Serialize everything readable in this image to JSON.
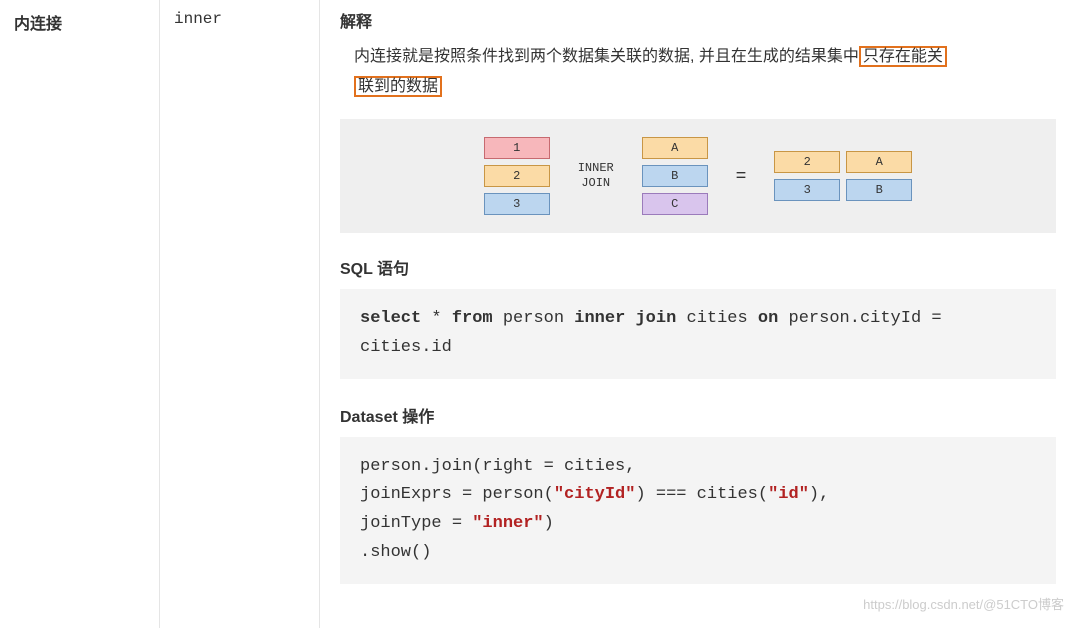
{
  "left": {
    "title": "内连接"
  },
  "mid": {
    "keyword": "inner"
  },
  "sections": {
    "explain_h": "解释",
    "explain_pre": "内连接就是按照条件找到两个数据集关联的数据, 并且在生成的结果集中",
    "explain_hl1": "只存在能关",
    "explain_hl2": "联到的数据",
    "sql_h": "SQL 语句",
    "dataset_h": "Dataset 操作"
  },
  "diagram": {
    "op": "INNER\nJOIN",
    "eq": "=",
    "left": [
      {
        "v": "1",
        "cls": "c-pink"
      },
      {
        "v": "2",
        "cls": "c-orange"
      },
      {
        "v": "3",
        "cls": "c-blue"
      }
    ],
    "right": [
      {
        "v": "A",
        "cls": "c-orange"
      },
      {
        "v": "B",
        "cls": "c-blue"
      },
      {
        "v": "C",
        "cls": "c-purple"
      }
    ],
    "result": [
      {
        "l": "2",
        "lcls": "c-orange",
        "r": "A",
        "rcls": "c-orange"
      },
      {
        "l": "3",
        "lcls": "c-blue",
        "r": "B",
        "rcls": "c-blue"
      }
    ]
  },
  "sql": {
    "tokens": [
      "select",
      " * ",
      "from",
      " person ",
      "inner join",
      " cities ",
      "on",
      " person.cityId = cities.id"
    ]
  },
  "ds": {
    "l1a": "person.join(right = cities,",
    "l2a": "  joinExprs = person(",
    "l2s1": "\"cityId\"",
    "l2b": ") === cities(",
    "l2s2": "\"id\"",
    "l2c": "),",
    "l3a": "  joinType = ",
    "l3s": "\"inner\"",
    "l3b": ")",
    "l4": "  .show()"
  },
  "watermark": "https://blog.csdn.net/@51CTO博客"
}
